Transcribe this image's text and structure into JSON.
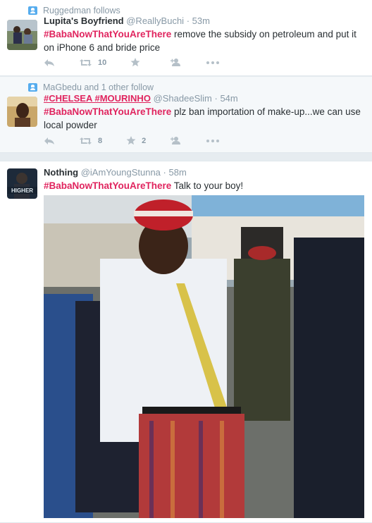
{
  "tweets": [
    {
      "context": "Ruggedman follows",
      "fullname": "Lupita's Boyfriend",
      "username": "@ReallyBuchi",
      "time": "53m",
      "hashtag": "#BabaNowThatYouAreThere",
      "text": " remove the subsidy on petroleum and put it on iPhone 6 and bride price",
      "retweets": "10",
      "favorites": ""
    },
    {
      "context": "MaGbedu and 1 other follow",
      "fullname": "#CHELSEA #MOURINHO",
      "username": "@ShadeeSlim",
      "time": "54m",
      "hashtag": "#BabaNowThatYouAreThere",
      "text": " plz ban importation of make-up...we can use local powder",
      "retweets": "8",
      "favorites": "2"
    },
    {
      "fullname": "Nothing",
      "username": "@iAmYoungStunna",
      "time": "58m",
      "hashtag": "#BabaNowThatYouAreThere",
      "text": " Talk to your boy!",
      "avatar_text": "HIGHER"
    }
  ],
  "dot": "·",
  "icons": {
    "context": "follow-context-icon",
    "reply": "reply-icon",
    "retweet": "retweet-icon",
    "favorite": "star-icon",
    "follow": "add-user-icon",
    "more": "more-icon"
  },
  "colors": {
    "hashtag": "#e0245e",
    "accent": "#55acee",
    "muted": "#8899a6",
    "text": "#292f33"
  }
}
